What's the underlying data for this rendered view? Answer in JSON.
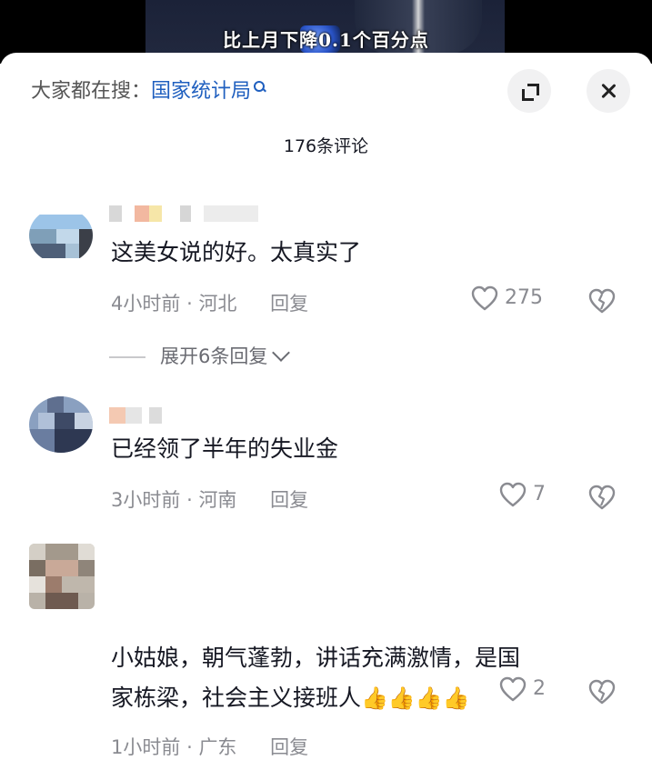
{
  "video": {
    "subtitle": "比上月下降0.1个百分点"
  },
  "search": {
    "prefix": "大家都在搜：",
    "term": "国家统计局"
  },
  "header": {
    "comment_count": "176条评论"
  },
  "comments": [
    {
      "text": "这美女说的好。太真实了",
      "time": "4小时前",
      "sep": "·",
      "location": "河北",
      "reply_label": "回复",
      "likes": "275",
      "expand_label": "展开6条回复"
    },
    {
      "text": "已经领了半年的失业金",
      "time": "3小时前",
      "sep": "·",
      "location": "河南",
      "reply_label": "回复",
      "likes": "7"
    },
    {
      "text_line1": "小姑娘，朝气蓬勃，讲话充满激情，是国",
      "text_line2": "家栋梁，社会主义接班人",
      "emoji": "👍👍👍👍",
      "time": "1小时前",
      "sep": "·",
      "location": "广东",
      "reply_label": "回复",
      "likes": "2"
    }
  ],
  "colors": {
    "accent_link": "#1f5fbf",
    "meta_gray": "#8a8b91",
    "thumb_color": "#f5b400"
  },
  "icons": {
    "search": "search-icon",
    "expand": "expand-icon",
    "close": "close-icon",
    "like": "heart-icon",
    "dislike": "broken-heart-icon",
    "chevron": "chevron-down-icon"
  }
}
